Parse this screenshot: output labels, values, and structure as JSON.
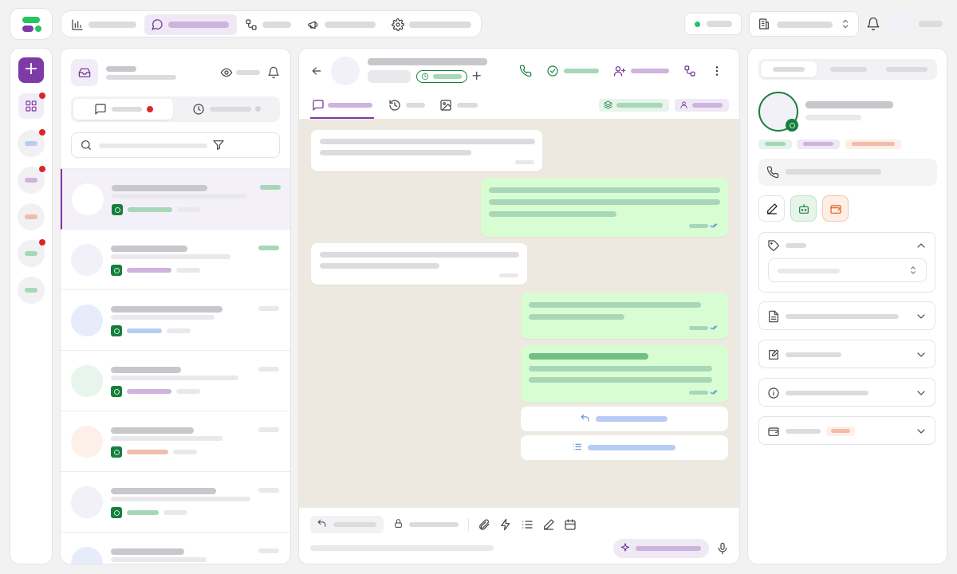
{
  "colors": {
    "brand_green": "#22c55e",
    "brand_purple": "#7e3aa6",
    "whatsapp_green": "#15803d",
    "outgoing_bubble": "#d9fdd3",
    "chat_background": "#ede9e1",
    "unread_red": "#dc2626",
    "status_online": "#22c55e"
  },
  "topnav": {
    "items": [
      {
        "icon": "bar-chart-icon",
        "active": false
      },
      {
        "icon": "message-circle-icon",
        "active": true
      },
      {
        "icon": "workflow-icon",
        "active": false
      },
      {
        "icon": "megaphone-icon",
        "active": false
      },
      {
        "icon": "settings-gear-icon",
        "active": false
      }
    ],
    "status": {
      "icon": "online-dot",
      "state": "online"
    },
    "workspace": {
      "icon": "building-icon"
    },
    "notifications": {
      "icon": "bell-icon"
    }
  },
  "rail": {
    "compose_glyph": "+",
    "items": [
      {
        "icon": "grid-icon",
        "unread": true
      },
      {
        "tag": "blue",
        "unread": true
      },
      {
        "tag": "purple",
        "unread": true
      },
      {
        "tag": "orange",
        "unread": false
      },
      {
        "tag": "green",
        "unread": true
      },
      {
        "tag": "green",
        "unread": false
      }
    ]
  },
  "inbox": {
    "header_icons": [
      "inbox-icon",
      "eye-icon",
      "bell-icon"
    ],
    "tabs": [
      {
        "icon": "chat-icon",
        "badge": "red",
        "active": true
      },
      {
        "icon": "clock-icon",
        "badge": "gray",
        "active": false
      }
    ],
    "search": {
      "icon": "search-icon",
      "filter_icon": "filter-icon"
    },
    "conversations": [
      {
        "avatar_color": "#ffffff",
        "label_color": "green",
        "selected": true,
        "time_color": "green"
      },
      {
        "avatar_color": "#f2f0f8",
        "label_color": "purple",
        "selected": false,
        "time_color": "green"
      },
      {
        "avatar_color": "#e7ecfb",
        "label_color": "blue",
        "selected": false,
        "time_color": "gray"
      },
      {
        "avatar_color": "#e8f5ec",
        "label_color": "purple",
        "selected": false,
        "time_color": "gray"
      },
      {
        "avatar_color": "#fdf0e8",
        "label_color": "orange",
        "selected": false,
        "time_color": "gray"
      },
      {
        "avatar_color": "#f2f0f8",
        "label_color": "green",
        "selected": false,
        "time_color": "gray"
      },
      {
        "avatar_color": "#e7ecfb",
        "label_color": "none",
        "selected": false,
        "time_color": "gray"
      }
    ]
  },
  "chat": {
    "header_icons": [
      "back-arrow-icon",
      "phone-icon",
      "check-circle-icon",
      "user-plus-icon",
      "workflow-icon",
      "more-vertical-icon"
    ],
    "add_glyph": "+",
    "tabs": [
      {
        "icon": "chat-icon",
        "active": true
      },
      {
        "icon": "history-icon",
        "active": false
      },
      {
        "icon": "image-icon",
        "active": false
      }
    ],
    "messages": [
      {
        "direction": "in",
        "lines": 2
      },
      {
        "direction": "out",
        "lines": 3,
        "read": true
      },
      {
        "direction": "in",
        "lines": 2
      },
      {
        "direction": "out",
        "lines": 2,
        "read": true
      },
      {
        "direction": "out",
        "lines": 3,
        "bold_first": true,
        "read": true
      }
    ],
    "quick_replies": [
      {
        "icon": "reply-icon"
      },
      {
        "icon": "list-icon"
      }
    ],
    "composer": {
      "toolbar_icons": [
        "reply-icon",
        "lock-icon",
        "paperclip-icon",
        "zap-icon",
        "list-icon",
        "pen-icon",
        "calendar-icon"
      ],
      "ai_icon": "sparkle-icon",
      "mic_icon": "mic-icon"
    }
  },
  "contact": {
    "tabs_count": 3,
    "tags": [
      "green",
      "purple",
      "orange"
    ],
    "phone_icon": "phone-icon",
    "actions": [
      "pen-icon",
      "bot-icon",
      "wallet-icon"
    ],
    "sections": [
      {
        "icon": "tag-icon",
        "expanded": true
      },
      {
        "icon": "file-text-icon",
        "expanded": false
      },
      {
        "icon": "note-edit-icon",
        "expanded": false
      },
      {
        "icon": "info-icon",
        "expanded": false
      },
      {
        "icon": "wallet-icon",
        "expanded": false,
        "badge": "orange"
      }
    ]
  }
}
